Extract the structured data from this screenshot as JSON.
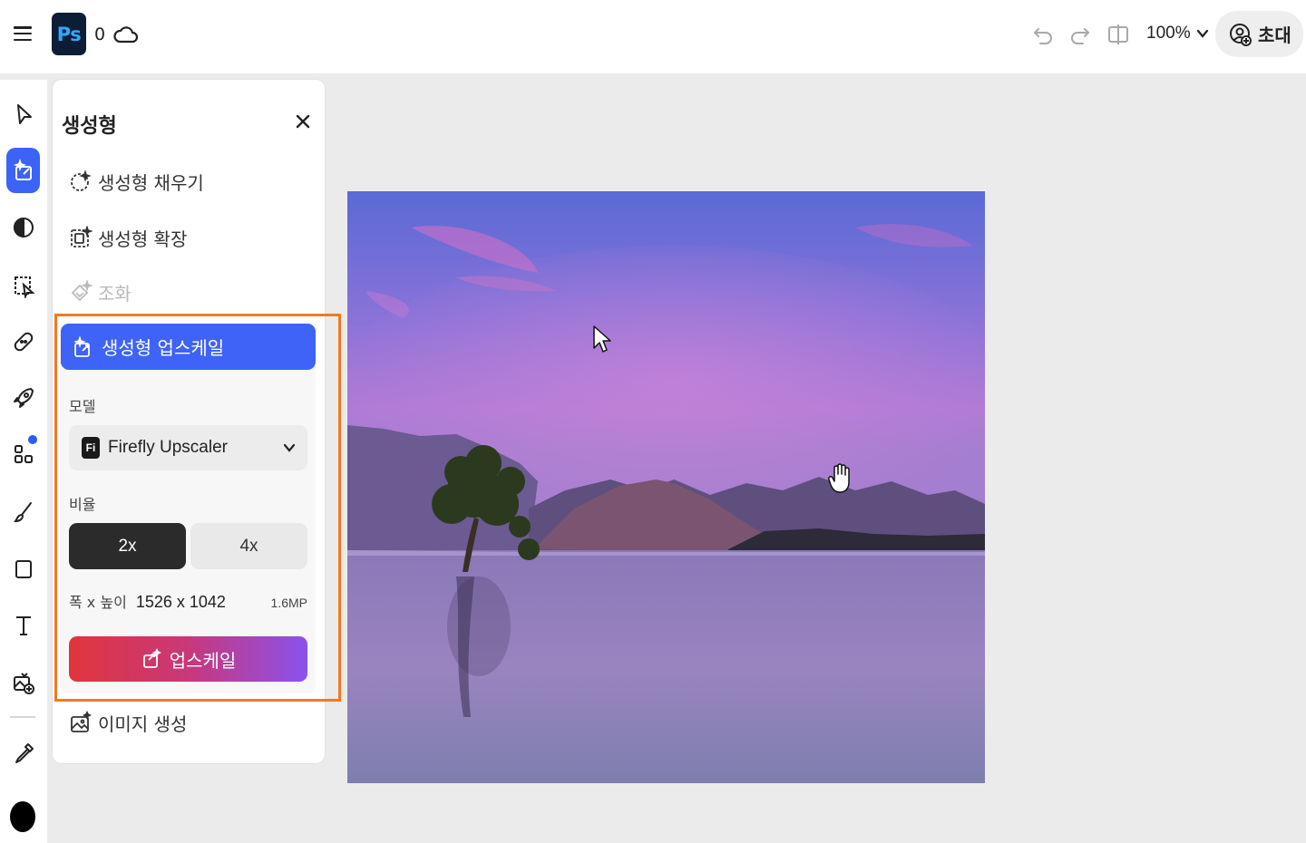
{
  "topbar": {
    "app_logo_text": "Ps",
    "notification_count": "0",
    "zoom_level": "100%",
    "invite_label": "초대"
  },
  "panel": {
    "title": "생성형",
    "items": [
      {
        "label": "생성형 채우기",
        "enabled": true
      },
      {
        "label": "생성형 확장",
        "enabled": true
      },
      {
        "label": "조화",
        "enabled": false
      }
    ],
    "upscale": {
      "header_label": "생성형 업스케일",
      "model_label": "모델",
      "model_badge": "Fi",
      "model_value": "Firefly Upscaler",
      "ratio_label": "비율",
      "ratio_options": [
        "2x",
        "4x"
      ],
      "ratio_selected": "2x",
      "dimension_label": "폭 x 높이",
      "dimension_value": "1526 x 1042",
      "megapixels": "1.6MP",
      "action_label": "업스케일"
    },
    "footer_item": {
      "label": "이미지 생성"
    }
  },
  "colors": {
    "accent_blue": "#3e63f6",
    "highlight_orange": "#f47a1f",
    "foreground_color": "#000000"
  }
}
